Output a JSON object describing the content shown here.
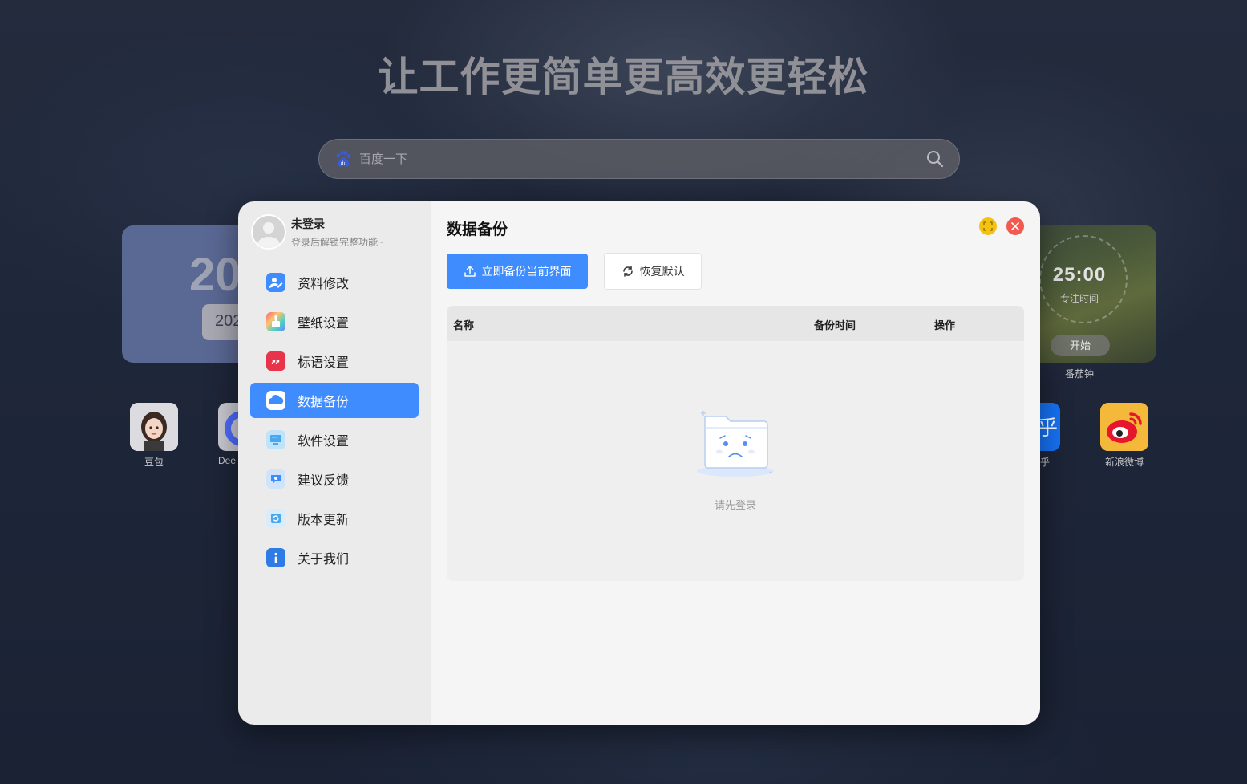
{
  "background": {
    "slogan": "让工作更简单更高效更轻松",
    "search": {
      "placeholder": "百度一下"
    },
    "date_card": {
      "big": "20",
      "small": "202"
    },
    "apps": [
      {
        "label": "豆包"
      },
      {
        "label": "Dee"
      },
      {
        "label": "乎"
      },
      {
        "label": "新浪微博"
      }
    ],
    "timer": {
      "time": "25:00",
      "subtitle": "专注时间",
      "start_label": "开始",
      "label": "番茄钟"
    }
  },
  "dialog": {
    "user": {
      "name": "未登录",
      "subtitle": "登录后解锁完整功能~"
    },
    "menu": [
      {
        "label": "资料修改",
        "icon": "profile-edit-icon",
        "color": "#3f8cff"
      },
      {
        "label": "壁纸设置",
        "icon": "wallpaper-brush-icon",
        "color": "#f2a23c"
      },
      {
        "label": "标语设置",
        "icon": "quote-icon",
        "color": "#e8344a"
      },
      {
        "label": "数据备份",
        "icon": "cloud-icon",
        "color": "#ffffff",
        "active": true
      },
      {
        "label": "软件设置",
        "icon": "monitor-icon",
        "color": "#4aa8ee"
      },
      {
        "label": "建议反馈",
        "icon": "feedback-icon",
        "color": "#3f8cff"
      },
      {
        "label": "版本更新",
        "icon": "update-icon",
        "color": "#4aa8ee"
      },
      {
        "label": "关于我们",
        "icon": "info-icon",
        "color": "#2f7be6"
      }
    ],
    "main": {
      "title": "数据备份",
      "backup_button": "立即备份当前界面",
      "restore_button": "恢复默认",
      "table": {
        "columns": [
          "名称",
          "备份时间",
          "操作"
        ],
        "empty_text": "请先登录"
      }
    },
    "colors": {
      "accent": "#3f8cff",
      "maximize": "#f4c312",
      "close": "#f25a4f"
    }
  }
}
